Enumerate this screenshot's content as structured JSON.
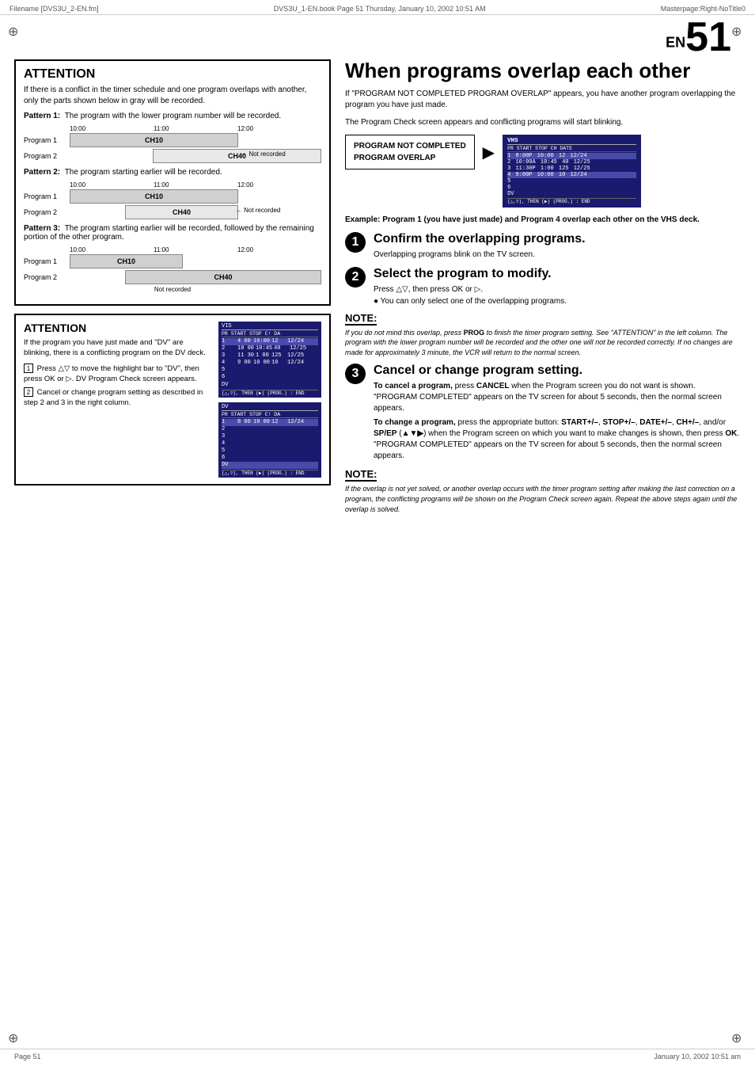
{
  "header": {
    "left": "Filename [DVS3U_2-EN.fm]",
    "center": "DVS3U_1-EN.book  Page 51  Thursday, January 10, 2002  10:51 AM",
    "right": "Masterpage:Right-NoTitle0"
  },
  "page_number": "51",
  "en_label": "EN",
  "left_col": {
    "attention1": {
      "title": "ATTENTION",
      "body": "If there is a conflict in the timer schedule and one program overlaps with another, only the parts shown below in gray will be recorded.",
      "patterns": [
        {
          "label": "Pattern 1:",
          "desc": "The program with the lower program number will be recorded."
        },
        {
          "label": "Pattern 2:",
          "desc": "The program starting earlier will be recorded."
        },
        {
          "label": "Pattern 3:",
          "desc": "The program starting earlier will be recorded, followed by the remaining portion of the other program."
        }
      ],
      "not_recorded": "Not recorded"
    },
    "attention2": {
      "title": "ATTENTION",
      "body": "If the program you have just made and \"DV\" are blinking, there is a conflicting program on the DV deck.",
      "steps": [
        "Press △▽ to move the highlight bar to \"DV\", then press OK or ▷. DV Program Check screen appears.",
        "Cancel or change program setting as described in step 2 and 3 in the right column."
      ]
    }
  },
  "right_col": {
    "title": "When programs overlap each other",
    "intro1": "If \"PROGRAM NOT COMPLETED PROGRAM OVERLAP\" appears, you have another program overlapping the program you have just made.",
    "intro2": "The Program Check screen appears and conflicting programs will start blinking.",
    "prog_not_completed": "PROGRAM NOT COMPLETED",
    "prog_overlap": "PROGRAM OVERLAP",
    "example_caption": "Example: Program 1 (you have just made) and Program 4 overlap each other on the VHS deck.",
    "steps": [
      {
        "number": "1",
        "heading": "Confirm the overlapping programs.",
        "body": "Overlapping programs blink on the TV screen."
      },
      {
        "number": "2",
        "heading": "Select the program to modify.",
        "body": "Press △▽, then press OK or ▷.",
        "bullet": "You can only select one of the overlapping programs."
      },
      {
        "number": "3",
        "heading": "Cancel or change program setting.",
        "body_cancel": "To cancel a program, press CANCEL when the Program screen you do not want is shown. \"PROGRAM COMPLETED\" appears on the TV screen for about 5 seconds, then the normal screen appears.",
        "body_change": "To change a program, press the appropriate button: START+/–, STOP+/–, DATE+/–, CH+/–, and/or SP/EP (▲▼▶) when the Program screen on which you want to make changes is shown, then press OK. \"PROGRAM COMPLETED\" appears on the TV screen for about 5 seconds, then the normal screen appears."
      }
    ],
    "note1": {
      "title": "NOTE:",
      "text": "If you do not mind this overlap, press PROG to finish the timer program setting. See \"ATTENTION\" in the left column. The program with the lower program number will be recorded and the other one will not be recorded correctly. If no changes are made for approximately 3 minute, the VCR will return to the normal screen."
    },
    "note2": {
      "title": "NOTE:",
      "text": "If the overlap is not yet solved, or another overlap occurs with the timer program setting after making the last correction on a program, the conflicting programs will be shown on the Program Check screen again. Repeat the above steps again until the overlap is solved."
    }
  },
  "footer": {
    "left": "Page 51",
    "right": "January 10, 2002 10:51 am"
  },
  "vhs_screen_right": {
    "title": "VHS",
    "headers": "PR  START    STOP   CH    DATE",
    "rows": [
      {
        "pr": "1",
        "start": "8:00P",
        "stop": "10:00",
        "ch": "12",
        "date": "12/24",
        "highlight": true
      },
      {
        "pr": "2",
        "start": "10:00A",
        "stop": "10:45",
        "ch": "40",
        "date": "12/25"
      },
      {
        "pr": "3",
        "start": "11:30P",
        "stop": "1:00",
        "ch": "125",
        "date": "12/25"
      },
      {
        "pr": "4",
        "start": "9:00P",
        "stop": "10:00",
        "ch": "10",
        "date": "12/24"
      },
      {
        "pr": "5",
        "start": "",
        "stop": "",
        "ch": "",
        "date": ""
      },
      {
        "pr": "6",
        "start": "",
        "stop": "",
        "ch": "",
        "date": ""
      },
      {
        "pr": "DV",
        "start": "",
        "stop": "",
        "ch": "",
        "date": ""
      }
    ],
    "footer_text": "(△,▽), THEN (▶) (PROG.) : END"
  },
  "vhs_screen_left1": {
    "title": "VIS",
    "headers": "PR  START   STOP   C!   DA",
    "rows": [
      {
        "pr": "1",
        "start": "4 00",
        "stop": "10:00",
        "ch": "12",
        "date": "12/24",
        "highlight": true
      },
      {
        "pr": "2",
        "start": "10 00",
        "stop": "10:45",
        "ch": "40",
        "date": "12/25"
      },
      {
        "pr": "3",
        "start": "11 30",
        "stop": "1 00",
        "ch": "125",
        "date": "12/25"
      },
      {
        "pr": "4",
        "start": "9 00",
        "stop": "10 00",
        "ch": "10",
        "date": "12/24"
      },
      {
        "pr": "5",
        "start": "",
        "stop": "",
        "ch": "",
        "date": ""
      },
      {
        "pr": "6",
        "start": "",
        "stop": "",
        "ch": "",
        "date": ""
      },
      {
        "pr": "DV",
        "start": "",
        "stop": "",
        "ch": "",
        "date": ""
      }
    ],
    "footer_text": "(△,▽), THEN (▶) (PROG.) : END"
  },
  "vhs_screen_left2": {
    "title": "DV",
    "headers": "PR  START   STOP   C!   DA",
    "rows": [
      {
        "pr": "1",
        "start": "8 00",
        "stop": "10 00",
        "ch": "12",
        "date": "12/24",
        "highlight": true
      },
      {
        "pr": "2",
        "start": "",
        "stop": "",
        "ch": "",
        "date": ""
      },
      {
        "pr": "3",
        "start": "",
        "stop": "",
        "ch": "",
        "date": ""
      },
      {
        "pr": "4",
        "start": "",
        "stop": "",
        "ch": "",
        "date": ""
      },
      {
        "pr": "5",
        "start": "",
        "stop": "",
        "ch": "",
        "date": ""
      },
      {
        "pr": "6",
        "start": "",
        "stop": "",
        "ch": "",
        "date": ""
      },
      {
        "pr": "DV",
        "start": "",
        "stop": "",
        "ch": "",
        "date": "",
        "highlight": true
      }
    ],
    "footer_text": "(△,▽), THEN (▶) (PROG.) : END"
  }
}
